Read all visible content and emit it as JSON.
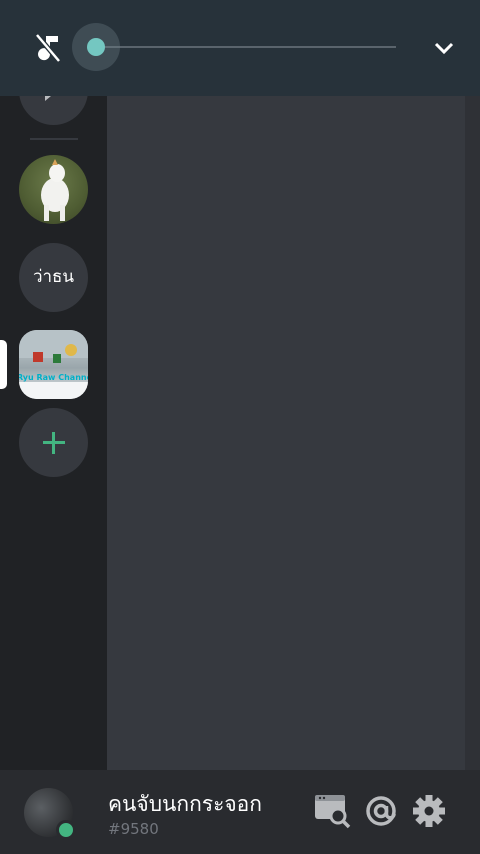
{
  "servers": [
    {
      "name": "server-top"
    },
    {
      "name": "dog"
    },
    {
      "label": "ว่าธน"
    },
    {
      "label": "Ryu Raw Channels",
      "selected": true
    },
    {
      "name": "add-server"
    }
  ],
  "user": {
    "name": "คนจับนกกระจอก",
    "discriminator": "#9580",
    "status": "online"
  },
  "music": {
    "progress": 0.0
  },
  "colors": {
    "accent": "#43b581",
    "slider": "#74c7c1",
    "background": "#36393f"
  }
}
